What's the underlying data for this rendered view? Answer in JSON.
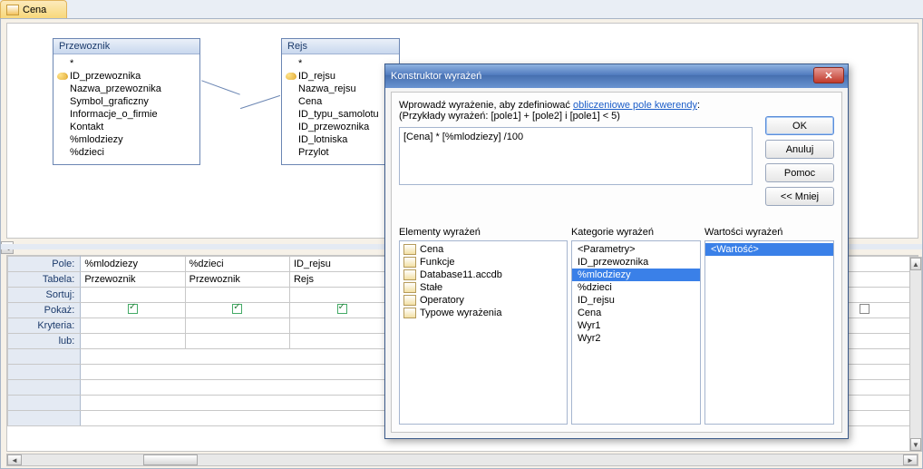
{
  "tab": {
    "label": "Cena"
  },
  "tables": {
    "t0": {
      "title": "Przewoznik",
      "fields": [
        "*",
        "ID_przewoznika",
        "Nazwa_przewoznika",
        "Symbol_graficzny",
        "Informacje_o_firmie",
        "Kontakt",
        "%mlodziezy",
        "%dzieci"
      ],
      "pk_index": 1
    },
    "t1": {
      "title": "Rejs",
      "fields": [
        "*",
        "ID_rejsu",
        "Nazwa_rejsu",
        "Cena",
        "ID_typu_samolotu",
        "ID_przewoznika",
        "ID_lotniska",
        "Przylot"
      ],
      "pk_index": 1
    }
  },
  "grid": {
    "labels": {
      "field": "Pole:",
      "table": "Tabela:",
      "sort": "Sortuj:",
      "show": "Pokaż:",
      "criteria": "Kryteria:",
      "or": "lub:"
    },
    "cols": [
      {
        "field": "%mlodziezy",
        "table": "Przewoznik",
        "show": true
      },
      {
        "field": "%dzieci",
        "table": "Przewoznik",
        "show": true
      },
      {
        "field": "ID_rejsu",
        "table": "Rejs",
        "show": true
      }
    ]
  },
  "dlg": {
    "title": "Konstruktor wyrażeń",
    "intro_prefix": "Wprowadź wyrażenie, aby zdefiniować ",
    "intro_link": "obliczeniowe pole kwerendy",
    "intro_suffix": ":",
    "example": "(Przykłady wyrażeń: [pole1] + [pole2] i [pole1] < 5)",
    "expression": "[Cena] * [%mlodziezy] /100",
    "buttons": {
      "ok": "OK",
      "cancel": "Anuluj",
      "help": "Pomoc",
      "less": "<< Mniej"
    },
    "cols": {
      "elements": "Elementy wyrażeń",
      "categories": "Kategorie wyrażeń",
      "values": "Wartości wyrażeń"
    },
    "elements": [
      "Cena",
      "Funkcje",
      "Database11.accdb",
      "Stałe",
      "Operatory",
      "Typowe wyrażenia"
    ],
    "categories": [
      "<Parametry>",
      "ID_przewoznika",
      "%mlodziezy",
      "%dzieci",
      "ID_rejsu",
      "Cena",
      "Wyr1",
      "Wyr2"
    ],
    "categories_selected": 2,
    "values": [
      "<Wartość>"
    ],
    "values_selected": 0
  }
}
